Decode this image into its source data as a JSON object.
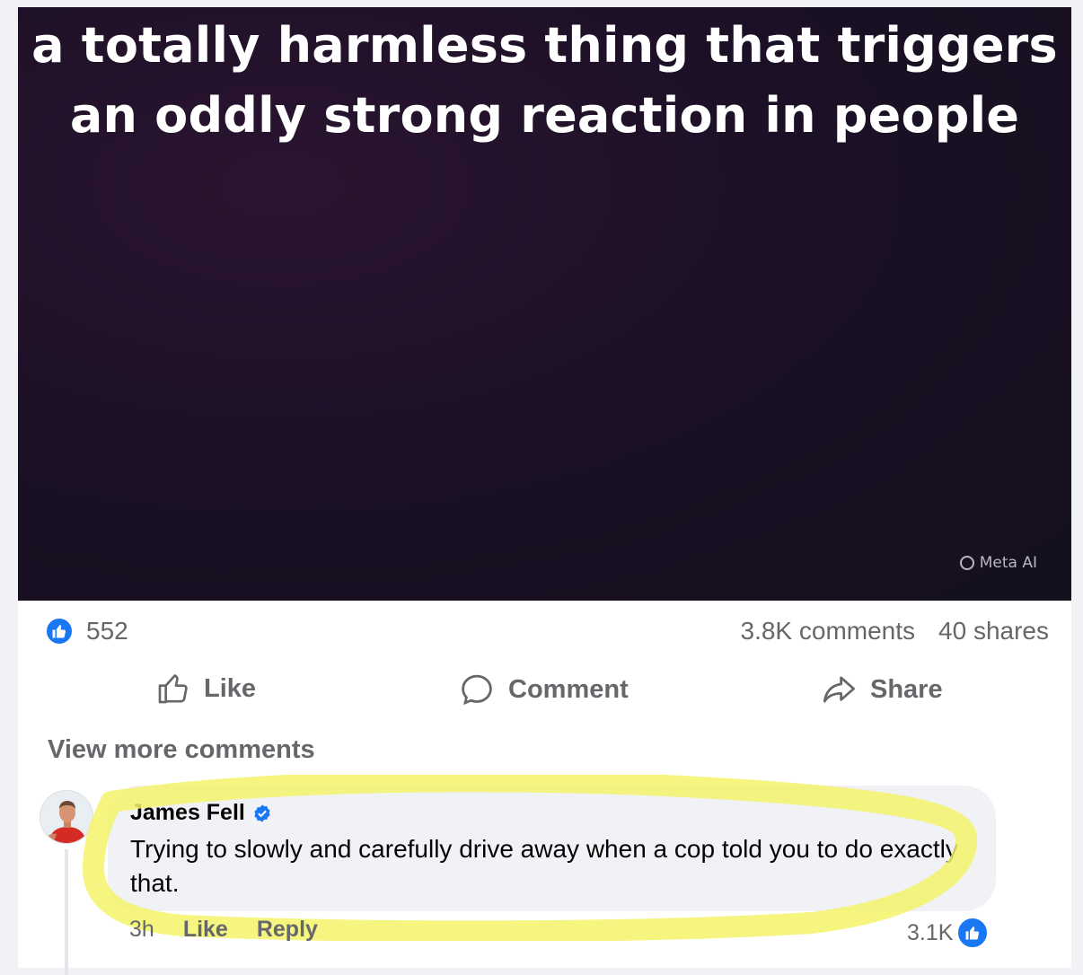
{
  "post": {
    "media_title_line1": "a totally harmless thing that triggers",
    "media_title_line2": "an oddly strong reaction in people",
    "watermark": "Meta AI"
  },
  "stats": {
    "likes": "552",
    "comments": "3.8K comments",
    "shares": "40 shares"
  },
  "actions": {
    "like": "Like",
    "comment": "Comment",
    "share": "Share"
  },
  "comments": {
    "view_more": "View more comments",
    "items": [
      {
        "author": "James Fell",
        "verified": true,
        "text": "Trying to slowly and carefully drive away when a cop told you to do exactly that.",
        "age": "3h",
        "like_label": "Like",
        "reply_label": "Reply",
        "reaction_count": "3.1K"
      }
    ]
  },
  "colors": {
    "accent": "#1877f2",
    "highlight": "#f3f36a",
    "muted_text": "#65676b"
  },
  "icons": [
    "like-icon",
    "comment-icon",
    "share-icon",
    "verified-badge-icon",
    "meta-ai-ring-icon"
  ]
}
